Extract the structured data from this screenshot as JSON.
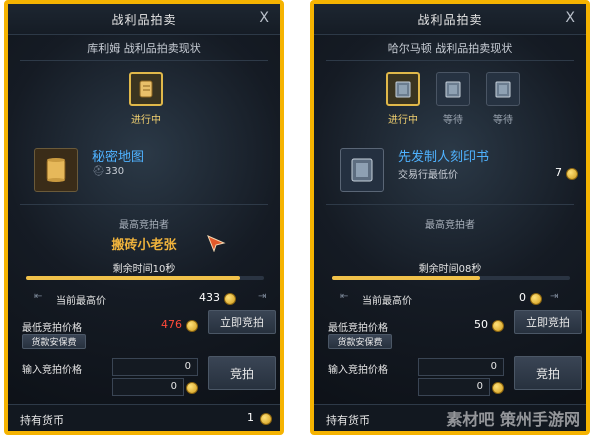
{
  "left": {
    "title": "战利品拍卖",
    "close": "X",
    "subtitle": "库利姆 战利品拍卖现状",
    "slots": [
      {
        "label": "进行中",
        "icon": "scroll-icon",
        "active": true
      }
    ],
    "item": {
      "name": "秘密地图",
      "count": "330",
      "icon": "map-scroll-icon"
    },
    "bidder_label": "最高竞拍者",
    "bidder_name": "搬砖小老张",
    "time_label": "剩余时间10秒",
    "progress": 0.9,
    "current_label": "当前最高价",
    "current_value": "433",
    "min_label": "最低竞拍价格",
    "min_value": "476",
    "buyout_button": "立即竞拍",
    "guarantee_button": "货款安保费",
    "input_label": "输入竞拍价格",
    "input_value": "0",
    "input_value2": "0",
    "bid_button": "竞拍",
    "currency_label": "持有货币",
    "currency_value": "1"
  },
  "right": {
    "title": "战利品拍卖",
    "close": "X",
    "subtitle": "哈尔马顿 战利品拍卖现状",
    "slots": [
      {
        "label": "进行中",
        "icon": "book-icon",
        "active": true
      },
      {
        "label": "等待",
        "icon": "book-icon",
        "active": false
      },
      {
        "label": "等待",
        "icon": "book-icon",
        "active": false
      }
    ],
    "item": {
      "name": "先发制人刻印书",
      "sub": "交易行最低价",
      "count": "7",
      "icon": "engraving-book-icon"
    },
    "bidder_label": "最高竞拍者",
    "time_label": "剩余时间08秒",
    "progress": 0.62,
    "current_label": "当前最高价",
    "current_value": "0",
    "min_label": "最低竞拍价格",
    "min_value": "50",
    "buyout_button": "立即竞拍",
    "guarantee_button": "货款安保费",
    "input_label": "输入竞拍价格",
    "input_value": "0",
    "input_value2": "0",
    "bid_button": "竞拍",
    "currency_label": "持有货币"
  },
  "watermark": "素材吧 策州手游网"
}
